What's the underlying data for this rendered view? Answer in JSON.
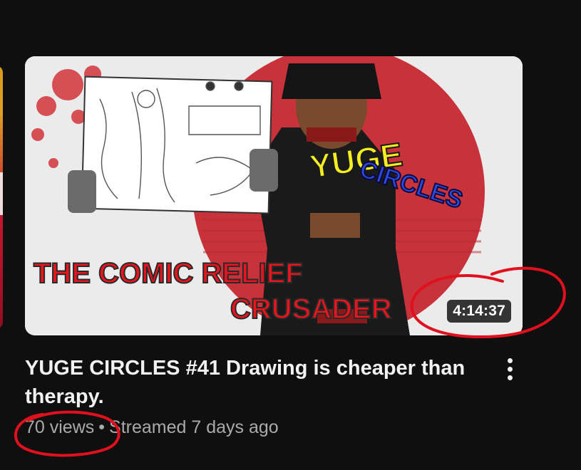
{
  "video": {
    "thumbnail_text": {
      "headline_line1": "THE COMIC RELIEF",
      "headline_line2": "CRUSADER",
      "logo_word1": "YUGE",
      "logo_word2": "CIRCLES"
    },
    "duration": "4:14:37",
    "title": "YUGE CIRCLES #41 Drawing is cheaper than therapy.",
    "views": "70 views",
    "separator": "•",
    "streamed": "Streamed 7 days ago",
    "menu_icon": "more-vertical-icon"
  },
  "colors": {
    "background": "#0f0f0f",
    "title": "#f1f1f1",
    "meta": "#aaaaaa",
    "annotation": "#e0101e",
    "thumb_red_sun": "#c8323a",
    "thumb_red_text": "#e8151e",
    "logo_yellow": "#f4ee21",
    "logo_blue": "#2c49e0"
  }
}
